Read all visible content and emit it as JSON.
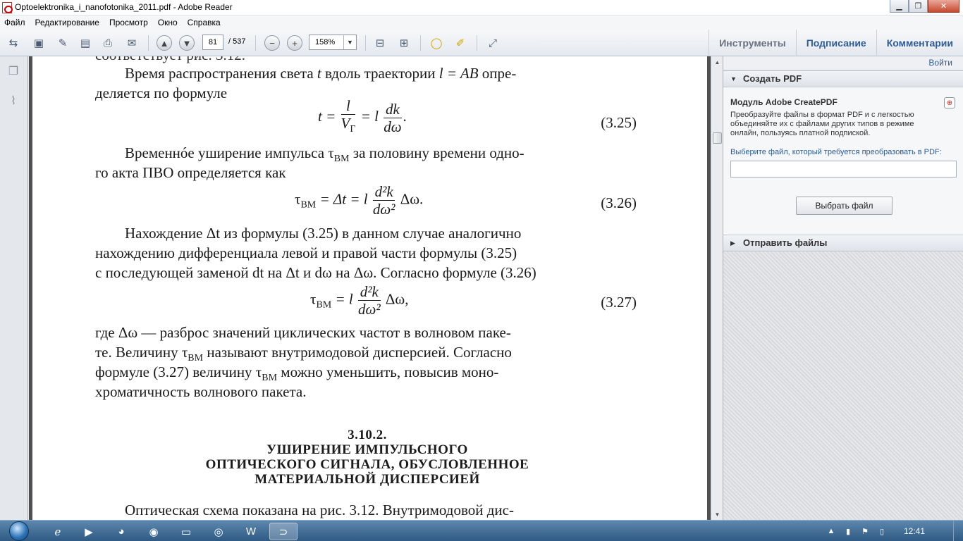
{
  "window": {
    "title": "Optoelektronika_i_nanofotonika_2011.pdf - Adobe Reader",
    "minimize": "▁",
    "maximize": "❐",
    "close": "✕"
  },
  "menu": [
    "Файл",
    "Редактирование",
    "Просмотр",
    "Окно",
    "Справка"
  ],
  "toolbar": {
    "page_current": "81",
    "page_total": "/ 537",
    "zoom": "158%",
    "zoom_arrow": "▼",
    "minus": "−",
    "plus": "+",
    "tabs": [
      "Инструменты",
      "Подписание",
      "Комментарии"
    ]
  },
  "document": {
    "cut_line": "соответствует рис. 3.12.",
    "para1_a": "Время распространения света",
    "para1_t": "t",
    "para1_b": "вдоль траектории",
    "para1_eq": "l = AB",
    "para1_c": "опре-",
    "para1_line2": "деляется по формуле",
    "f25_lhs": "t =",
    "f25_n1": "l",
    "f25_d1": "V",
    "f25_d1sub": "Г",
    "f25_mid": "= l",
    "f25_n2": "dk",
    "f25_d2": "dω",
    "f25_end": ".",
    "eq25": "(3.25)",
    "para2": "Временнóе уширение импульса τ",
    "para2_sub": "ВМ",
    "para2_b": "за половину времени одно-",
    "para2_line2": "го акта ПВО определяется как",
    "f26_lhs": "τ",
    "f26_sub": "ВМ",
    "f26_mid": "= Δt = l",
    "f26_num": "d²k",
    "f26_den": "dω²",
    "f26_end": "Δω.",
    "eq26": "(3.26)",
    "para3_l1": "Нахождение Δt из формулы (3.25) в данном случае аналогично",
    "para3_l2": "нахождению дифференциала левой и правой части формулы (3.25)",
    "para3_l3": "с последующей заменой dt на Δt и dω на Δω. Согласно формуле (3.26)",
    "f27_lhs": "τ",
    "f27_sub": "ВМ",
    "f27_mid": "= l",
    "f27_num": "d²k",
    "f27_den": "dω²",
    "f27_end": "Δω,",
    "eq27": "(3.27)",
    "para4_l1": "где Δω — разброс значений циклических частот в волновом паке-",
    "para4_l2a": "те. Величину τ",
    "para4_l2sub": "ВМ",
    "para4_l2b": "называют внутримодовой дисперсией. Согласно",
    "para4_l3a": "формуле (3.27) величину τ",
    "para4_l3sub": "ВМ",
    "para4_l3b": "можно уменьшить, повысив моно-",
    "para4_l4": "хроматичность волнового пакета.",
    "heading_num": "3.10.2.",
    "heading_l1": "УШИРЕНИЕ ИМПУЛЬСНОГО",
    "heading_l2": "ОПТИЧЕСКОГО СИГНАЛА, ОБУСЛОВЛЕННОЕ",
    "heading_l3": "МАТЕРИАЛЬНОЙ ДИСПЕРСИЕЙ",
    "para5": "Оптическая схема показана на рис. 3.12. Внутримодовой дис-"
  },
  "panel": {
    "login": "Войти",
    "create_pdf": "Создать PDF",
    "module_title": "Модуль Adobe CreatePDF",
    "module_desc": "Преобразуйте файлы в формат PDF и с легкостью объединяйте их с файлами других типов в режиме онлайн, пользуясь платной подпиской.",
    "choose_label": "Выберите файл, который требуется преобразовать в PDF:",
    "choose_button": "Выбрать файл",
    "send_files": "Отправить файлы"
  },
  "taskbar": {
    "clock": "12:41"
  },
  "colors": {
    "accent_blue": "#2d5c97",
    "taskbar": "#2e5a84"
  }
}
